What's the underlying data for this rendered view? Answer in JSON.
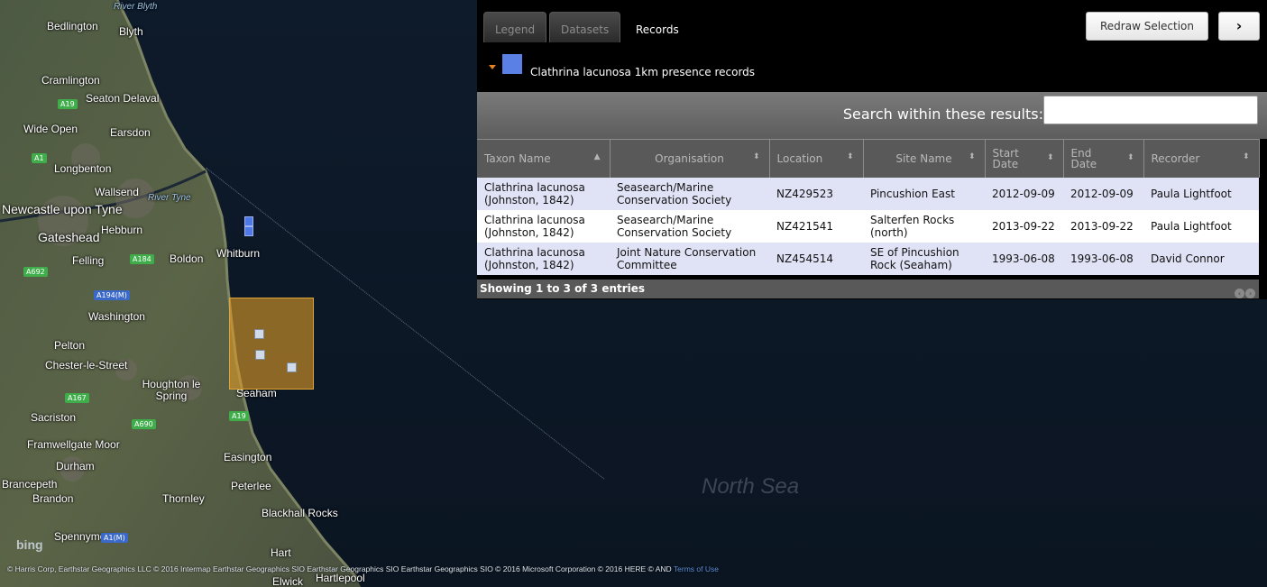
{
  "map": {
    "place_labels": [
      "River Blyth",
      "Bedlington",
      "Blyth",
      "Cramlington",
      "Seaton Delaval",
      "Wide Open",
      "Earsdon",
      "Longbenton",
      "Wallsend",
      "River Tyne",
      "Newcastle upon Tyne",
      "Hebburn",
      "Gateshead",
      "Whitburn",
      "Felling",
      "Boldon",
      "Washington",
      "Pelton",
      "Chester-le-Street",
      "Houghton le Spring",
      "Seaham",
      "Sacriston",
      "Framwellgate Moor",
      "Durham",
      "Easington",
      "Brancepeth",
      "Brandon",
      "Peterlee",
      "Thornley",
      "Blackhall Rocks",
      "Spennymoor",
      "Hart",
      "Hartlepool",
      "Elwick"
    ],
    "road_labels": [
      "A19",
      "A1",
      "A184",
      "A692",
      "A194(M)",
      "A167",
      "A690",
      "A1(M)"
    ],
    "sea_label": "North Sea",
    "bing": "bing",
    "attribution": "© Harris Corp, Earthstar Geographics LLC © 2016 Intermap Earthstar Geographics SIO Earthstar Geographics SIO Earthstar Geographics SIO © 2016 Microsoft Corporation © 2016 HERE © AND",
    "terms_link": "Terms of Use",
    "colors": {
      "selection": "#dba026",
      "marker": "#4f79e6"
    }
  },
  "tabs": [
    {
      "label": "Legend",
      "active": false
    },
    {
      "label": "Datasets",
      "active": false
    },
    {
      "label": "Records",
      "active": true
    }
  ],
  "toolbar": {
    "redraw_label": "Redraw Selection",
    "next_icon": "›"
  },
  "layer": {
    "name": "Clathrina lacunosa 1km presence records",
    "color": "#5a80e6"
  },
  "search": {
    "label": "Search within these results:",
    "value": ""
  },
  "table": {
    "columns": [
      "Taxon Name",
      "Organisation",
      "Location",
      "Site Name",
      "Start Date",
      "End Date",
      "Recorder"
    ],
    "rows": [
      [
        "Clathrina lacunosa (Johnston, 1842)",
        "Seasearch/Marine Conservation Society",
        "NZ429523",
        "Pincushion East",
        "2012-09-09",
        "2012-09-09",
        "Paula Lightfoot"
      ],
      [
        "Clathrina lacunosa (Johnston, 1842)",
        "Seasearch/Marine Conservation Society",
        "NZ421541",
        "Salterfen Rocks (north)",
        "2013-09-22",
        "2013-09-22",
        "Paula Lightfoot"
      ],
      [
        "Clathrina lacunosa (Johnston, 1842)",
        "Joint Nature Conservation Committee",
        "NZ454514",
        "SE of Pincushion Rock (Seaham)",
        "1993-06-08",
        "1993-06-08",
        "David Connor"
      ]
    ],
    "footer": "Showing 1 to 3 of 3 entries"
  }
}
